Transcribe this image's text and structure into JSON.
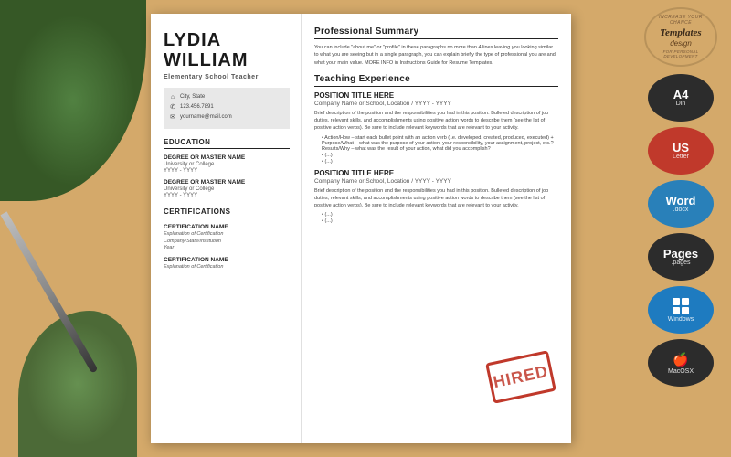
{
  "resume": {
    "name": {
      "first": "LYDIA",
      "last": "WILLIAM"
    },
    "job_title": "Elementary School Teacher",
    "contact": {
      "location": "City, State",
      "phone": "123.456.7891",
      "email": "yourname@mail.com"
    },
    "education": {
      "section_title": "Education",
      "degrees": [
        {
          "name": "DEGREE OR MASTER NAME",
          "school": "University or College",
          "years": "YYYY - YYYY"
        },
        {
          "name": "DEGREE OR MASTER NAME",
          "school": "University or College",
          "years": "YYYY - YYYY"
        }
      ]
    },
    "certifications": {
      "section_title": "Certifications",
      "items": [
        {
          "name": "CERTIFICATION NAME",
          "explanation": "Explanation of Certification",
          "institution": "Company/State/Institution",
          "year": "Year"
        },
        {
          "name": "CERTIFICATION NAME",
          "explanation": "Explanation of Certification"
        }
      ]
    },
    "summary": {
      "title": "Professional Summary",
      "text": "You can include \"about me\" or \"profile\" in these paragraphs no more than 4 lines leaving you looking similar to what you are seeing but in a single paragraph, you can explain briefly the type of professional you are and what your main value. MORE INFO in Instructions Guide for Resume Templates."
    },
    "experience": {
      "title": "Teaching Experience",
      "positions": [
        {
          "title": "POSITION TITLE HERE",
          "company": "Company Name or School, Location / YYYY - YYYY",
          "description": "Brief description of the position and the responsibilities you had in this position. Bulleted description of job duties, relevant skills, and accomplishments using positive action words to describe them (see the list of positive action verbs). Be sure to include relevant keywords that are relevant to your activity.",
          "action_bullet": "Action/How – start each bullet point with an action verb (i.e. developed, created, produced, executed) + Purpose/What – what was the purpose of your action, your responsibility, your assignment, project, etc.? + Results/Why – what was the result of your action, what did you accomplish?",
          "bullets": [
            "(...)",
            "(...)"
          ]
        },
        {
          "title": "POSITION TITLE HERE",
          "company": "Company Name or School, Location / YYYY - YYYY",
          "description": "Brief description of the position and the responsibilities you had in this position. Bulleted description of job duties, relevant skills, and accomplishments using positive action words to describe them (see the list of positive action verbs). Be sure to include relevant keywords that are relevant to your activity.",
          "bullets": [
            "(...)",
            "(...)"
          ]
        }
      ]
    },
    "hired_stamp": "HIRED"
  },
  "sidebar": {
    "templates_label": "Templates",
    "templates_design": "design",
    "tagline": "INCREASE YOUR CHANCE FOR PERSONAL DEVELOPMENT"
  },
  "format_buttons": [
    {
      "main": "A4",
      "sub": "Din",
      "style": "dark"
    },
    {
      "main": "US",
      "sub": "Letter",
      "style": "red"
    },
    {
      "main": "Word",
      "sub": ".docx",
      "style": "blue"
    },
    {
      "main": "Pages",
      "sub": ".pages",
      "style": "dark"
    },
    {
      "main": "Windows",
      "sub": "",
      "style": "win-blue",
      "is_windows": true
    },
    {
      "main": "MacOSX",
      "sub": "",
      "style": "mac-dark",
      "is_apple": true
    }
  ]
}
